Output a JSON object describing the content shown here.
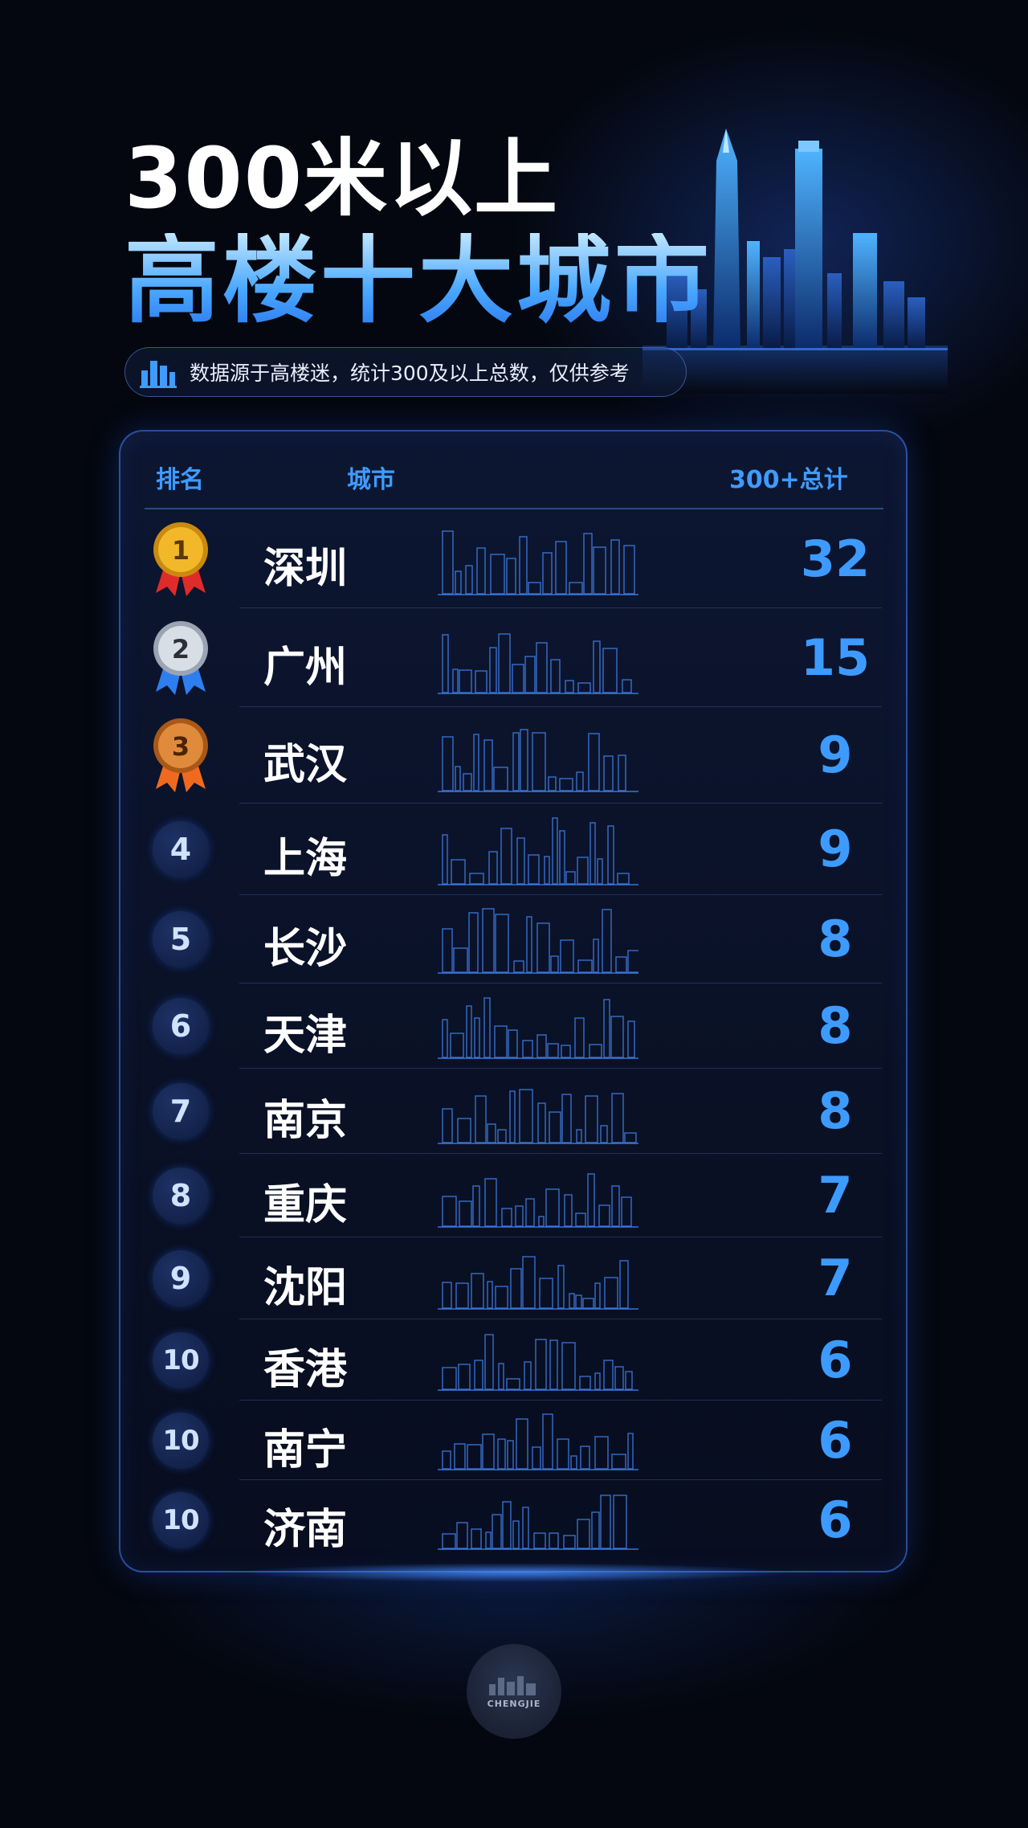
{
  "title": {
    "line1": "300米以上",
    "line2": "高楼十大城市"
  },
  "source_note": {
    "icon": "buildings-icon",
    "text": "数据源于高楼迷，统计300及以上总数，仅供参考"
  },
  "table": {
    "headers": {
      "rank": "排名",
      "city": "城市",
      "total": "300+总计"
    },
    "rows": [
      {
        "rank": "1",
        "city": "深圳",
        "total": "32",
        "medal": "gold"
      },
      {
        "rank": "2",
        "city": "广州",
        "total": "15",
        "medal": "silver"
      },
      {
        "rank": "3",
        "city": "武汉",
        "total": "9",
        "medal": "bronze"
      },
      {
        "rank": "4",
        "city": "上海",
        "total": "9"
      },
      {
        "rank": "5",
        "city": "长沙",
        "total": "8"
      },
      {
        "rank": "6",
        "city": "天津",
        "total": "8"
      },
      {
        "rank": "7",
        "city": "南京",
        "total": "8"
      },
      {
        "rank": "8",
        "city": "重庆",
        "total": "7"
      },
      {
        "rank": "9",
        "city": "沈阳",
        "total": "7"
      },
      {
        "rank": "10",
        "city": "香港",
        "total": "6"
      },
      {
        "rank": "10",
        "city": "南宁",
        "total": "6"
      },
      {
        "rank": "10",
        "city": "济南",
        "total": "6"
      }
    ]
  },
  "logo": {
    "text": "CHENGJIE"
  },
  "colors": {
    "accent": "#3d9bff",
    "background": "#04070f",
    "gold": "#f2b82a",
    "silver": "#cfd6df",
    "bronze": "#e08a3c",
    "ribbon_red": "#e02b2b",
    "ribbon_blue": "#2f7ef0",
    "ribbon_orange": "#ef6a1f"
  }
}
